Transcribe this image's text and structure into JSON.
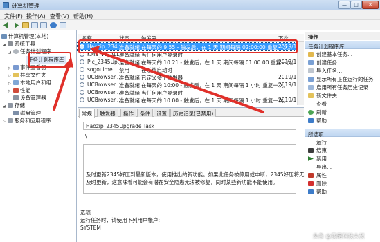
{
  "window": {
    "title": "计算机管理",
    "min": "—",
    "max": "□",
    "close": "✕"
  },
  "menu": [
    "文件(F)",
    "操作(A)",
    "查看(V)",
    "帮助(H)"
  ],
  "tree": [
    {
      "label": "计算机管理(本地)"
    },
    {
      "label": "系统工具"
    },
    {
      "label": "任务计划程序"
    },
    {
      "label": "任务计划程序库"
    },
    {
      "label": "事件查看器"
    },
    {
      "label": "共享文件夹"
    },
    {
      "label": "本地用户和组"
    },
    {
      "label": "性能"
    },
    {
      "label": "设备管理器"
    },
    {
      "label": "存储"
    },
    {
      "label": "磁盘管理"
    },
    {
      "label": "服务和应用程序"
    }
  ],
  "tasks": {
    "columns": [
      "名称",
      "状态",
      "触发器",
      "下次"
    ],
    "rows": [
      {
        "name": "Haozip_234...",
        "status": "准备就绪",
        "trigger": "在每天的 9:55 - 触发后，在 1 天 期间每隔 02:00:00 重复一次。",
        "next": "2019/1"
      },
      {
        "name": "KMS_VL_ALL",
        "status": "准备就绪",
        "trigger": "当任何用户登录时",
        "next": ""
      },
      {
        "name": "Plc_2345Up...",
        "status": "准备就绪",
        "trigger": "在每天的 10:21 - 触发后，在 1 天 期间每隔 01:00:00 重复一次。",
        "next": "2019/1"
      },
      {
        "name": "sogouime...",
        "status": "禁用",
        "trigger": "在系统启动时",
        "next": ""
      },
      {
        "name": "UCBrowser...",
        "status": "准备就绪",
        "trigger": "已定义多个触发器",
        "next": "2019/1"
      },
      {
        "name": "UCBrowser...",
        "status": "准备就绪",
        "trigger": "在每天的 10:00 - 触发后，在 1 天 期间每隔 1 小时 重复一次。",
        "next": "2019/1"
      },
      {
        "name": "UCBrowser...",
        "status": "准备就绪",
        "trigger": "当任何用户登录时",
        "next": ""
      },
      {
        "name": "UCBrowser...",
        "status": "准备就绪",
        "trigger": "在每天的 10:00 - 触发后，在 1 天 期间每隔 1 小时 重复一次。",
        "next": "2019/1"
      }
    ]
  },
  "detail": {
    "tabs": [
      "常规",
      "触发器",
      "操作",
      "条件",
      "设置",
      "历史记录(已禁用)"
    ],
    "name_label": "名称:",
    "task_name": "Haozip_2345Upgrade Task",
    "location": "\\",
    "description": "及时更新2345好压到最新版本，使用推出的新功能。如果此任务被停用或中断，2345好压将无法",
    "description2": "及时更新，这意味着可能会有潜在安全隐患无法被修复，同时某些新功能不能使用。",
    "security_label": "选项",
    "run_as_label": "运行任务时，请使用下列用户帐户:",
    "run_as_value": "SYSTEM"
  },
  "actions": {
    "header": "操作",
    "sections": [
      {
        "title": "任务计划程序库",
        "items": [
          "创建基本任务...",
          "创建任务...",
          "导入任务...",
          "显示所有正在运行的任务",
          "启用所有任务历史记录",
          "新文件夹...",
          "查看",
          "刷新",
          "帮助"
        ]
      },
      {
        "title": "所选项",
        "items": [
          "运行",
          "结束",
          "禁用",
          "导出...",
          "属性",
          "删除",
          "帮助"
        ]
      }
    ]
  },
  "watermark": "头条 @我是科技大叔",
  "colors": {
    "selection": "#3399ff",
    "annotation": "#e0302a",
    "sub_header": "#c9ddf3"
  }
}
